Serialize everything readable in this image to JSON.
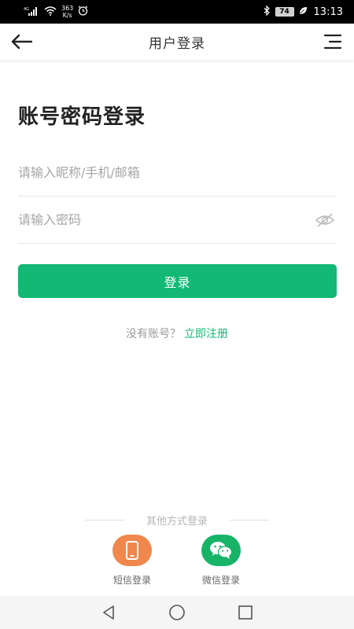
{
  "status_bar": {
    "network": "4G",
    "speed_value": "363",
    "speed_unit": "K/s",
    "battery": "74",
    "time": "13:13"
  },
  "header": {
    "title": "用户登录",
    "back_icon": "arrow-left-icon",
    "menu_icon": "menu-icon"
  },
  "login": {
    "heading": "账号密码登录",
    "username_placeholder": "请输入昵称/手机/邮箱",
    "username_value": "",
    "password_placeholder": "请输入密码",
    "password_value": "",
    "submit_label": "登录",
    "no_account_text": "没有账号？",
    "register_link": "立即注册"
  },
  "other_login": {
    "label": "其他方式登录",
    "methods": [
      {
        "label": "短信登录",
        "icon": "phone-icon",
        "color": "#f0874c"
      },
      {
        "label": "微信登录",
        "icon": "wechat-icon",
        "color": "#17b468"
      }
    ]
  },
  "colors": {
    "accent": "#12b873",
    "sms": "#f0874c",
    "wechat": "#17b468"
  }
}
